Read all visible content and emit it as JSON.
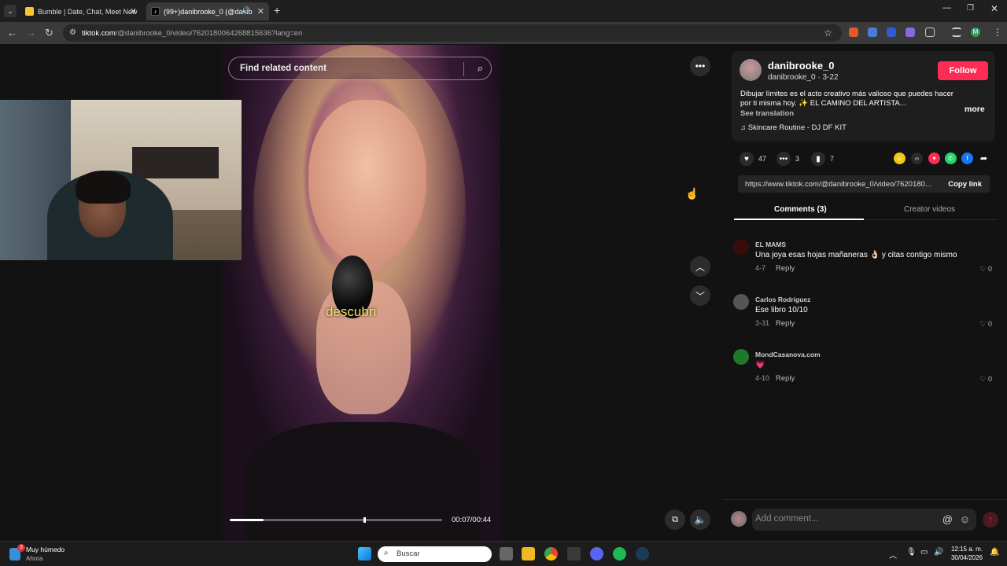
{
  "browser": {
    "tabs": [
      {
        "title": "Bumble | Date, Chat, Meet New",
        "active": false
      },
      {
        "title": "(99+)danibrooke_0 (@danib",
        "active": true
      }
    ],
    "new_tab_icon": "plus-icon",
    "url_domain": "tiktok.com",
    "url_path": "/@danibrooke_0/video/7620180064268815636?lang=en",
    "window_controls": [
      "minimize",
      "restore",
      "close"
    ]
  },
  "video": {
    "search_placeholder": "Find related content",
    "subtitle": "descubri",
    "time": "00:07/00:44",
    "progress": 0.16
  },
  "post": {
    "username": "danibrooke_0",
    "handle_date": "danibrooke_0 · 3-22",
    "follow_label": "Follow",
    "description": "Dibujar límites es el acto creativo más valioso que puedes hacer por ti misma hoy. ✨ EL CAMINO DEL ARTISTA...",
    "more_label": "more",
    "see_translation": "See translation",
    "music": "Skincare Routine - DJ DF KIT",
    "likes": "47",
    "comments": "3",
    "saves": "7",
    "link": "https://www.tiktok.com/@danibrooke_0/video/7620180...",
    "copy_link_label": "Copy link"
  },
  "panel_tabs": {
    "comments": "Comments (3)",
    "creator_videos": "Creator videos"
  },
  "comments": [
    {
      "name": "EL MAMS",
      "text": "Una joya esas hojas mañaneras 👌🏻 y citas contigo mismo",
      "date": "4-7",
      "reply": "Reply",
      "likes": "0",
      "avatar_color": "#3a0b0b"
    },
    {
      "name": "Carlos Rodriguez",
      "text": "Ese libro 10/10",
      "date": "3-31",
      "reply": "Reply",
      "likes": "0",
      "avatar_color": "#555555"
    },
    {
      "name": "MondCasanova.com",
      "text": "💗",
      "date": "4-10",
      "reply": "Reply",
      "likes": "0",
      "avatar_color": "#1e7a2a"
    }
  ],
  "comment_input": {
    "placeholder": "Add comment..."
  },
  "taskbar": {
    "weather_badge": "3",
    "weather_title": "Muy húmedo",
    "weather_sub": "Ahora",
    "search_placeholder": "Buscar",
    "time": "12:15 a. m.",
    "date": "30/04/2026"
  },
  "colors": {
    "accent": "#fe2c55",
    "panel_bg": "#121212",
    "card_bg": "#1e1e1e"
  }
}
